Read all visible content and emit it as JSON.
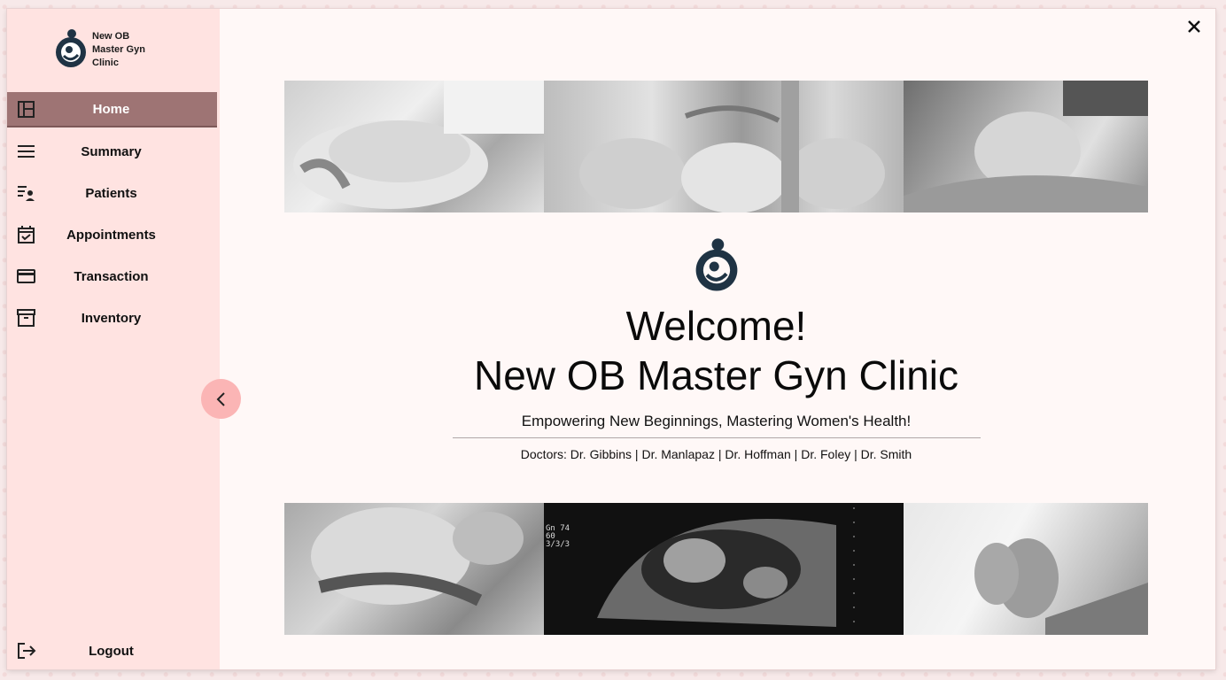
{
  "brand": {
    "name_line1": "New OB",
    "name_line2": "Master Gyn",
    "name_line3": "Clinic",
    "logo_icon": "mother-child-logo-icon",
    "logo_color": "#1f3344"
  },
  "sidebar": {
    "items": [
      {
        "label": "Home",
        "icon": "dashboard-icon",
        "active": true
      },
      {
        "label": "Summary",
        "icon": "menu-lines-icon",
        "active": false
      },
      {
        "label": "Patients",
        "icon": "patient-list-icon",
        "active": false
      },
      {
        "label": "Appointments",
        "icon": "calendar-check-icon",
        "active": false
      },
      {
        "label": "Transaction",
        "icon": "credit-card-icon",
        "active": false
      },
      {
        "label": "Inventory",
        "icon": "archive-box-icon",
        "active": false
      }
    ],
    "logout_label": "Logout",
    "active_color": "#9e7474",
    "background_color": "#ffe3e1"
  },
  "main": {
    "welcome": "Welcome!",
    "clinic_name": "New OB Master Gyn Clinic",
    "tagline": "Empowering New Beginnings, Mastering Women's Health!",
    "doctors": "Doctors: Dr. Gibbins | Dr. Manlapaz | Dr. Hoffman | Dr. Foley | Dr. Smith"
  },
  "photos": {
    "top": [
      "pregnant-belly-photo",
      "group-pregnant-bellies-photo",
      "pregnant-woman-sitting-photo"
    ],
    "bottom": [
      "mother-holding-baby-photo",
      "ultrasound-scan-photo",
      "baby-feet-photo"
    ],
    "ultrasound_text": [
      "Gn 74",
      "60",
      "3/3/3"
    ]
  }
}
